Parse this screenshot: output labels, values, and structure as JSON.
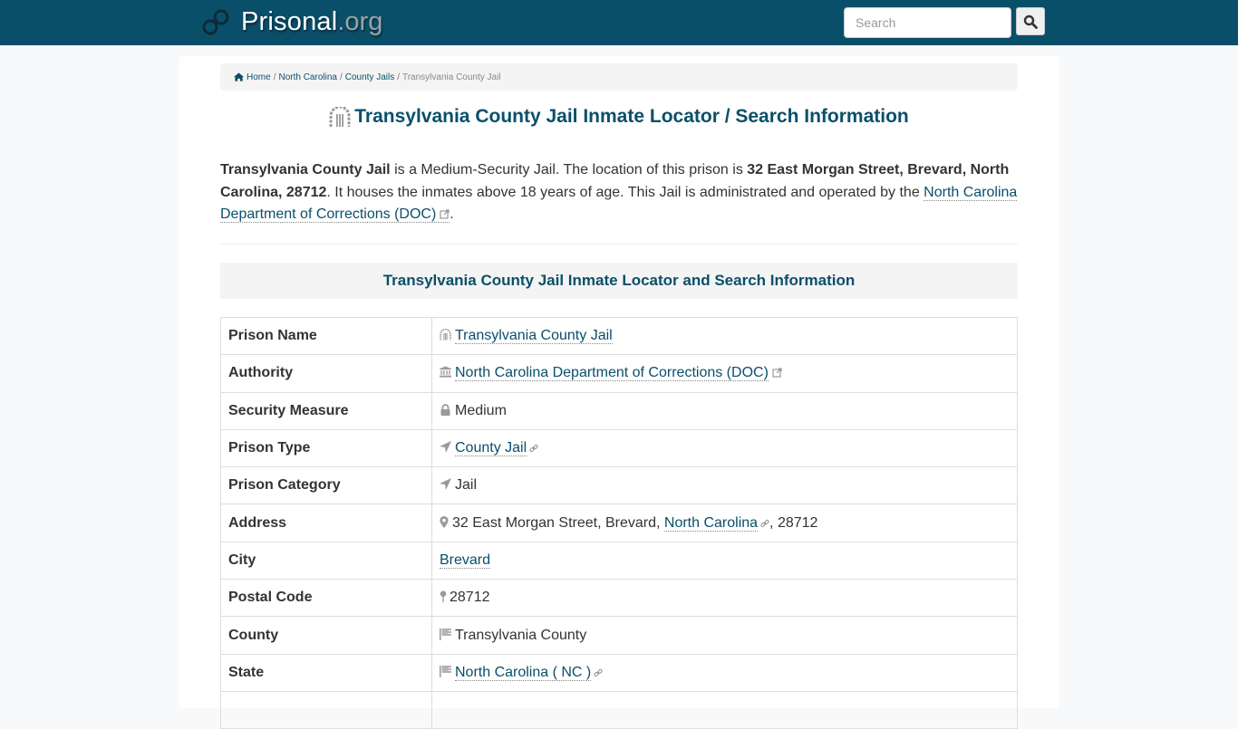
{
  "header": {
    "brand_name": "Prisonal",
    "brand_tld": ".org",
    "search_placeholder": "Search",
    "colors": {
      "navbar": "#0a4f6a",
      "accent": "#0a4f6a"
    }
  },
  "breadcrumb": {
    "items": [
      {
        "label": "Home",
        "icon": "home-icon"
      },
      {
        "label": "North Carolina"
      },
      {
        "label": "County Jails"
      }
    ],
    "current": "Transylvania County Jail",
    "separator": "/"
  },
  "page": {
    "title": "Transylvania County Jail Inmate Locator / Search Information",
    "intro": {
      "name": "Transylvania County Jail",
      "t1": " is a Medium-Security Jail. The location of this prison is ",
      "address": "32 East Morgan Street, Brevard, North Carolina, 28712",
      "t2": ". It houses the inmates above 18 years of age. This Jail is administrated and operated by the ",
      "authority_link": "North Carolina Department of Corrections (DOC)",
      "t3": "."
    },
    "section_title": "Transylvania County Jail Inmate Locator and Search Information"
  },
  "table": {
    "rows": [
      {
        "key": "Prison Name",
        "value": "Transylvania County Jail",
        "icon": "prison-icon"
      },
      {
        "key": "Authority",
        "value": "North Carolina Department of Corrections (DOC)",
        "icon": "bank-icon"
      },
      {
        "key": "Security Measure",
        "value": "Medium",
        "icon": "lock-icon"
      },
      {
        "key": "Prison Type",
        "value": "County Jail",
        "icon": "location-arrow-icon"
      },
      {
        "key": "Prison Category",
        "value": "Jail",
        "icon": "location-arrow-icon"
      },
      {
        "key": "Address",
        "value_prefix": "32 East Morgan Street, Brevard, ",
        "value_link": "North Carolina",
        "value_suffix": ", 28712",
        "icon": "map-marker-icon"
      },
      {
        "key": "City",
        "value": "Brevard"
      },
      {
        "key": "Postal Code",
        "value": "28712",
        "icon": "map-pin-icon"
      },
      {
        "key": "County",
        "value": "Transylvania County",
        "icon": "flag-icon"
      },
      {
        "key": "State",
        "value": "North Carolina ( NC )",
        "icon": "flag-icon"
      }
    ]
  }
}
